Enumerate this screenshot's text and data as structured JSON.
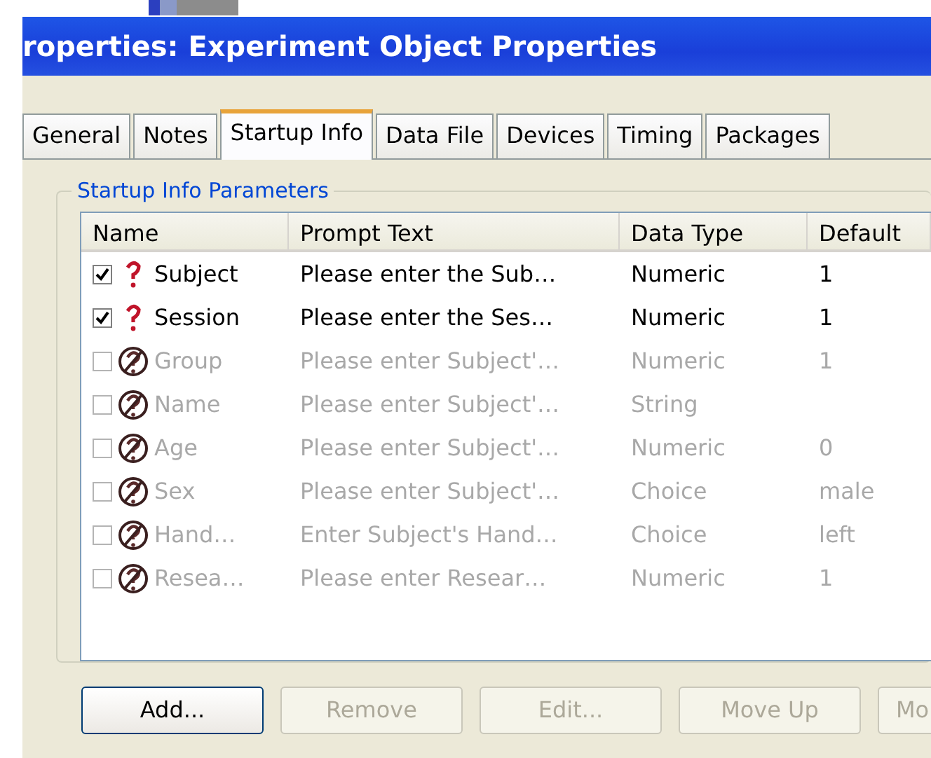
{
  "window": {
    "title": "roperties: Experiment Object Properties"
  },
  "tabs": [
    {
      "label": "General",
      "selected": false
    },
    {
      "label": "Notes",
      "selected": false
    },
    {
      "label": "Startup Info",
      "selected": true
    },
    {
      "label": "Data File",
      "selected": false
    },
    {
      "label": "Devices",
      "selected": false
    },
    {
      "label": "Timing",
      "selected": false
    },
    {
      "label": "Packages",
      "selected": false
    }
  ],
  "group": {
    "title": "Startup Info Parameters"
  },
  "table": {
    "columns": [
      "Name",
      "Prompt Text",
      "Data Type",
      "Default"
    ],
    "rows": [
      {
        "checked": true,
        "disabled": false,
        "cells": [
          "Subject",
          "Please enter the Sub…",
          "Numeric",
          "1"
        ]
      },
      {
        "checked": true,
        "disabled": false,
        "cells": [
          "Session",
          "Please enter the Ses…",
          "Numeric",
          "1"
        ]
      },
      {
        "checked": false,
        "disabled": true,
        "cells": [
          "Group",
          "Please enter Subject'…",
          "Numeric",
          "1"
        ]
      },
      {
        "checked": false,
        "disabled": true,
        "cells": [
          "Name",
          "Please enter Subject'…",
          "String",
          ""
        ]
      },
      {
        "checked": false,
        "disabled": true,
        "cells": [
          "Age",
          "Please enter Subject'…",
          "Numeric",
          "0"
        ]
      },
      {
        "checked": false,
        "disabled": true,
        "cells": [
          "Sex",
          "Please enter Subject'…",
          "Choice",
          "male"
        ]
      },
      {
        "checked": false,
        "disabled": true,
        "cells": [
          "Hand…",
          "Enter Subject's Hand…",
          "Choice",
          "left"
        ]
      },
      {
        "checked": false,
        "disabled": true,
        "cells": [
          "Resea…",
          "Please enter Resear…",
          "Numeric",
          "1"
        ]
      }
    ]
  },
  "buttons": [
    {
      "label": "Add...",
      "disabled": false
    },
    {
      "label": "Remove",
      "disabled": true
    },
    {
      "label": "Edit...",
      "disabled": true
    },
    {
      "label": "Move Up",
      "disabled": true
    },
    {
      "label": "Mo",
      "disabled": true
    }
  ]
}
